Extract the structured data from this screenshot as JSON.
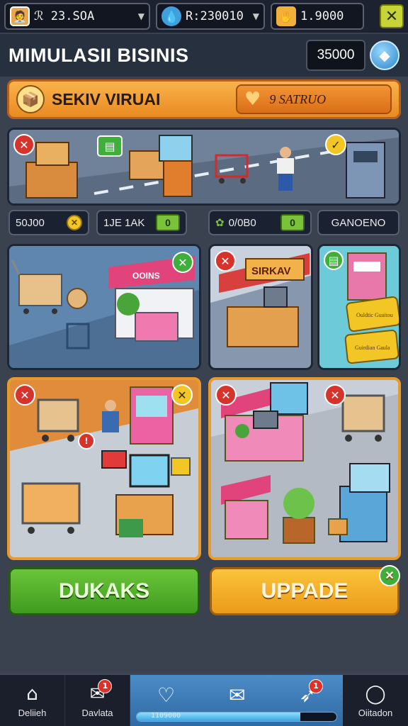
{
  "topbar": {
    "res1": {
      "value": "ℛ 23.SOA",
      "icon": "shop-icon"
    },
    "res2": {
      "value": "R:230010",
      "icon": "gem-icon"
    },
    "res3": {
      "value": "1.9000",
      "icon": "gold-bar-icon"
    },
    "close_label": "✕"
  },
  "header": {
    "title": "MIMULASII BISINIS",
    "balance": "35000"
  },
  "banner": {
    "title": "SEKIV VIRUAI",
    "right_text": "9 SATRUO"
  },
  "stats": [
    {
      "label": "50J00"
    },
    {
      "label": "1JE 1AK",
      "badge": "0"
    },
    {
      "label": "0/0B0",
      "badge": "0"
    },
    {
      "label": "GANOENO"
    }
  ],
  "scenes": {
    "stall_sign": "SIRKAV",
    "stall_ticket1": "Ouldtic Guaitou",
    "stall_ticket2": "Guirdian Gaula",
    "top_awning": "OOINS"
  },
  "buttons": {
    "left": "DUKAKS",
    "right": "UPPADE"
  },
  "nav": {
    "home_label": "Deliieh",
    "orders_label": "Davlata",
    "progress_text": "1109000",
    "progress_fraction": 0.82,
    "profile_label": "Oiitadon",
    "badge_orders": "1",
    "badge_boost": "1"
  },
  "colors": {
    "accent_orange": "#e98a22",
    "accent_green": "#3f9b1f",
    "accent_yellow": "#eb9a1a",
    "nav_blue": "#2f6aa4"
  }
}
